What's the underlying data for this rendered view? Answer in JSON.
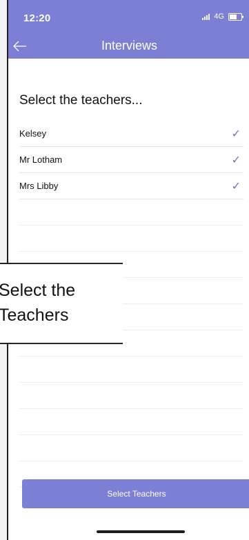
{
  "status_bar": {
    "time": "12:20",
    "network": "4G"
  },
  "nav": {
    "title": "Interviews",
    "back_icon": "arrow-left-icon"
  },
  "main": {
    "heading": "Select the teachers...",
    "teachers": [
      {
        "name": "Kelsey",
        "selected": true
      },
      {
        "name": "Mr Lotham",
        "selected": true
      },
      {
        "name": "Mrs Libby",
        "selected": true
      }
    ],
    "check_glyph": "✓",
    "button_label": "Select Teachers"
  },
  "callout": {
    "line1": "Select the",
    "line2": "Teachers"
  },
  "colors": {
    "accent": "#7c7fd4",
    "check": "#6b6fdc"
  }
}
